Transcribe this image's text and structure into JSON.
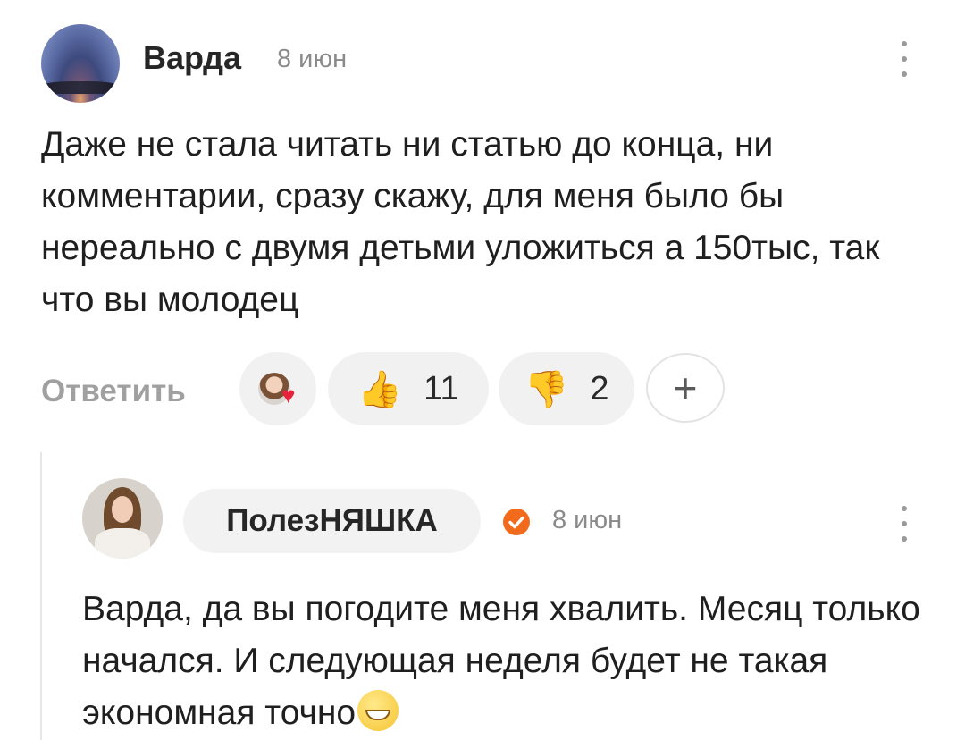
{
  "main_comment": {
    "author": "Варда",
    "date": "8 июн",
    "text": "Даже не стала читать ни статью до конца, ни комментарии, сразу скажу, для меня было бы нереально с двумя детьми уложиться а 150тыс, так что вы молодец",
    "actions": {
      "reply_label": "Ответить",
      "like_count": "11",
      "dislike_count": "2",
      "add_label": "+",
      "like_icon": "👍",
      "dislike_icon": "👎",
      "heart_icon": "♥"
    }
  },
  "reply": {
    "author": "ПолезНЯШКА",
    "date": "8 июн",
    "text": "Варда, да вы погодите меня хвалить. Месяц только начался. И следующая неделя будет не такая экономная точно",
    "emoji": "grinning-face",
    "verified_color": "#f26b1d"
  }
}
